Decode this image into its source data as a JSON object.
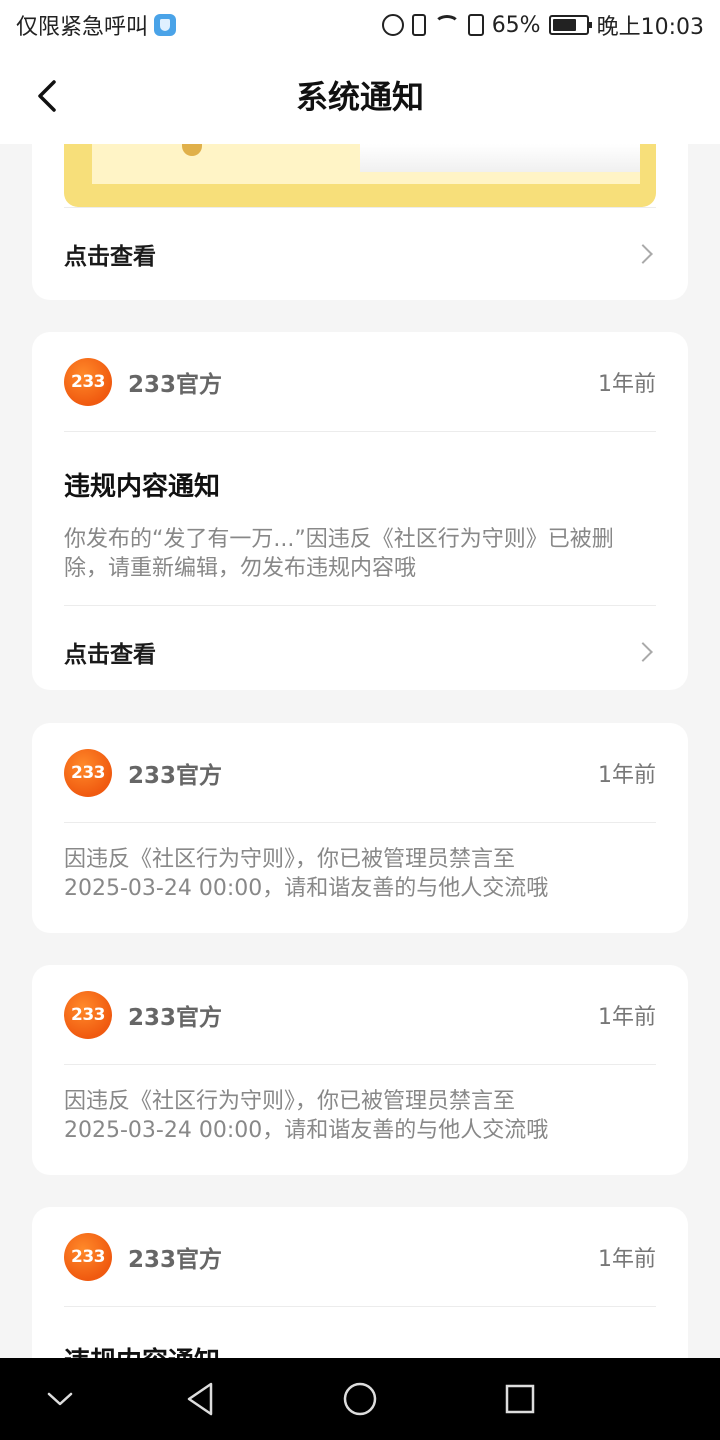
{
  "status_bar": {
    "carrier": "仅限紧急呼叫",
    "battery": "65%",
    "time": "晚上10:03",
    "icons": [
      "shield-icon",
      "nfc-icon",
      "vibrate-icon",
      "wifi-icon",
      "sim-alert-icon",
      "battery-icon"
    ]
  },
  "header": {
    "title": "系统通知",
    "back_icon": "chevron-left-icon"
  },
  "cards": [
    {
      "view_label": "点击查看"
    },
    {
      "sender": "233官方",
      "avatar_text": "233",
      "time": "1年前",
      "title": "违规内容通知",
      "body": "你发布的“发了有一万...”因违反《社区行为守则》已被删除，请重新编辑，勿发布违规内容哦",
      "view_label": "点击查看"
    },
    {
      "sender": "233官方",
      "avatar_text": "233",
      "time": "1年前",
      "body": "因违反《社区行为守则》，你已被管理员禁言至2025-03-24 00:00，请和谐友善的与他人交流哦"
    },
    {
      "sender": "233官方",
      "avatar_text": "233",
      "time": "1年前",
      "body": "因违反《社区行为守则》，你已被管理员禁言至2025-03-24 00:00，请和谐友善的与他人交流哦"
    },
    {
      "sender": "233官方",
      "avatar_text": "233",
      "time": "1年前",
      "title": "违规内容通知"
    }
  ],
  "nav_bar": {
    "icons": [
      "hide-nav-icon",
      "back-triangle-icon",
      "home-circle-icon",
      "recents-square-icon"
    ]
  }
}
